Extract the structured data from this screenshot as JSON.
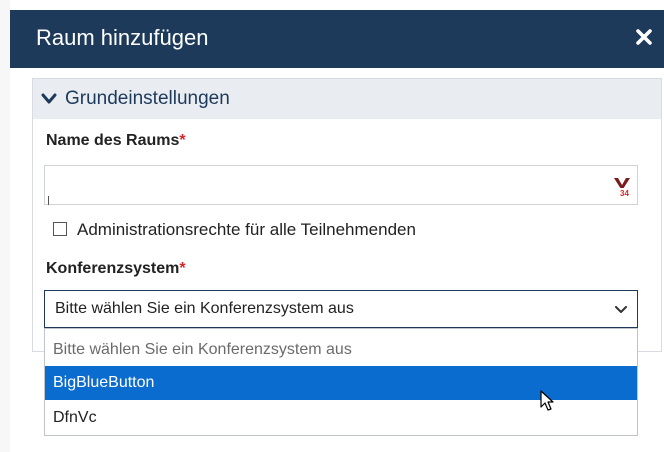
{
  "dialog": {
    "title": "Raum hinzufügen",
    "close_icon": "close-icon"
  },
  "section": {
    "label": "Grundeinstellungen",
    "toggle_icon": "chevron-down-icon"
  },
  "form": {
    "name_label": "Name des Raums",
    "name_required_mark": "*",
    "name_value": "",
    "name_addon_icon": "password-manager-icon",
    "admin_checkbox_label": "Administrationsrechte für alle Teilnehmenden",
    "admin_checkbox_checked": false,
    "conference_label": "Konferenzsystem",
    "conference_required_mark": "*",
    "conference_selected": "Bitte wählen Sie ein Konferenzsystem aus"
  },
  "dropdown": {
    "options": [
      {
        "label": "Bitte wählen Sie ein Konferenzsystem aus",
        "state": "placeholder"
      },
      {
        "label": "BigBlueButton",
        "state": "highlighted"
      },
      {
        "label": "DfnVc",
        "state": "normal"
      }
    ]
  },
  "colors": {
    "header_bg": "#1d3a5b",
    "section_bg": "#e9ecf1",
    "required": "#d9262a",
    "highlight": "#0b6ccf"
  }
}
